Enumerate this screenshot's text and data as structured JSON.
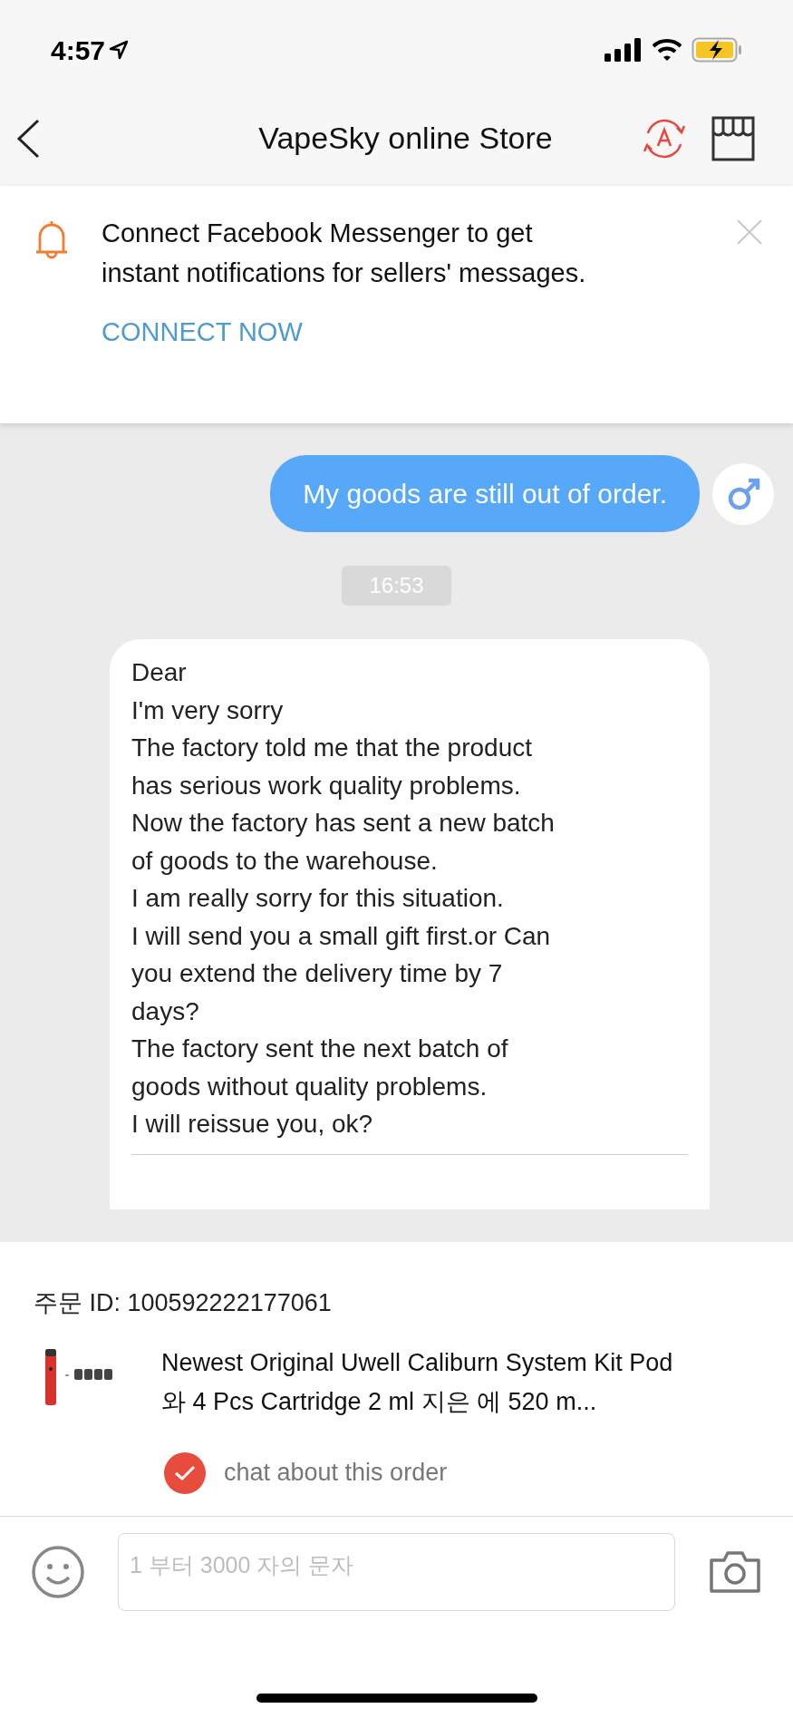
{
  "status_bar": {
    "time": "4:57"
  },
  "nav": {
    "title": "VapeSky online Store"
  },
  "banner": {
    "text": "Connect Facebook Messenger to get instant notifications for sellers' messages.",
    "action": "CONNECT NOW"
  },
  "messages": [
    {
      "kind": "sent",
      "text": "My goods are still out of order."
    },
    {
      "kind": "time",
      "text": "16:53"
    },
    {
      "kind": "received",
      "text": "Dear\nI'm very sorry\nThe factory told me that the product\nhas serious work quality problems.\nNow the factory has sent a new batch\nof goods to the warehouse.\nI am really sorry for this situation.\nI will send you a small gift first.or Can\nyou extend the delivery time by 7\ndays?\nThe factory sent the next batch of\ngoods without quality problems.\nI will reissue you, ok?"
    }
  ],
  "order": {
    "id_label": "주문 ID: 100592222177061",
    "product_title": "Newest Original Uwell Caliburn System Kit Pod 와 4 Pcs Cartridge 2 ml 지은 에 520 m...",
    "chat_about": {
      "label": "chat about this order",
      "checked": true
    }
  },
  "composer": {
    "placeholder": "1 부터 3000 자의 문자"
  }
}
